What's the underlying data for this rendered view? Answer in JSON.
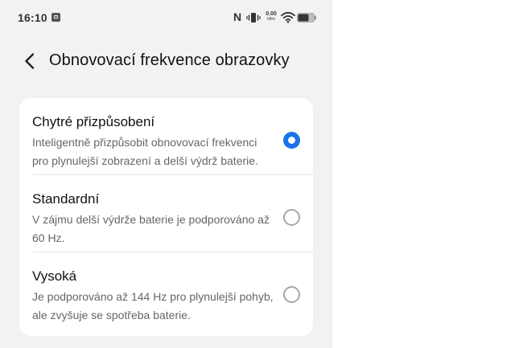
{
  "status_bar": {
    "time": "16:10",
    "nfc_glyph": "N",
    "network_speed_value": "0.00",
    "network_speed_unit": "kB/s",
    "icons": [
      "notification-icon",
      "nfc-icon",
      "vibrate-icon",
      "wifi-icon",
      "battery-icon"
    ]
  },
  "header": {
    "back_icon": "chevron-left-icon",
    "title": "Obnovovací frekvence obrazovky"
  },
  "options": [
    {
      "title": "Chytré přizpůsobení",
      "description": "Inteligentně přizpůsobit obnovovací frekvenci pro plynulejší zobrazení a delší výdrž baterie.",
      "selected": true
    },
    {
      "title": "Standardní",
      "description": "V zájmu delší výdrže baterie je podporováno až 60 Hz.",
      "selected": false
    },
    {
      "title": "Vysoká",
      "description": "Je podporováno až 144 Hz pro plynulejší pohyb, ale zvyšuje se spotřeba baterie.",
      "selected": false
    }
  ],
  "colors": {
    "accent": "#1a73e8",
    "background": "#f2f2f2",
    "card": "#ffffff",
    "unselected_radio": "#a6a6a6"
  }
}
